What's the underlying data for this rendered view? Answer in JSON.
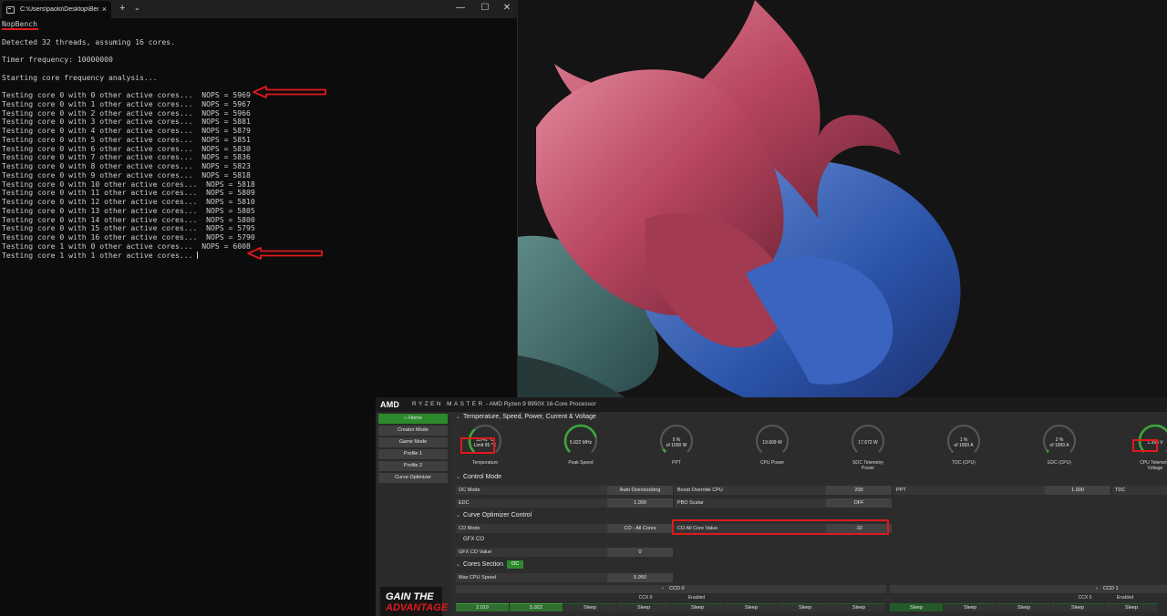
{
  "terminal": {
    "tab_title": "C:\\Users\\paolo\\Desktop\\Benc",
    "tab_close": "×",
    "new_tab": "+",
    "tab_dropdown": "⌄",
    "window_controls": {
      "minimize": "—",
      "maximize": "☐",
      "close": "✕"
    },
    "header_lines": [
      "NopBench",
      "",
      "Detected 32 threads, assuming 16 cores.",
      "",
      "Timer frequency: 10000000",
      "",
      "Starting core frequency analysis...",
      ""
    ],
    "results": [
      "Testing core 0 with 0 other active cores...  NOPS = 5969",
      "Testing core 0 with 1 other active cores...  NOPS = 5967",
      "Testing core 0 with 2 other active cores...  NOPS = 5966",
      "Testing core 0 with 3 other active cores...  NOPS = 5881",
      "Testing core 0 with 4 other active cores...  NOPS = 5879",
      "Testing core 0 with 5 other active cores...  NOPS = 5851",
      "Testing core 0 with 6 other active cores...  NOPS = 5830",
      "Testing core 0 with 7 other active cores...  NOPS = 5836",
      "Testing core 0 with 8 other active cores...  NOPS = 5823",
      "Testing core 0 with 9 other active cores...  NOPS = 5818",
      "Testing core 0 with 10 other active cores...  NOPS = 5818",
      "Testing core 0 with 11 other active cores...  NOPS = 5809",
      "Testing core 0 with 12 other active cores...  NOPS = 5810",
      "Testing core 0 with 13 other active cores...  NOPS = 5805",
      "Testing core 0 with 14 other active cores...  NOPS = 5800",
      "Testing core 0 with 15 other active cores...  NOPS = 5795",
      "Testing core 0 with 16 other active cores...  NOPS = 5790",
      "Testing core 1 with 0 other active cores...  NOPS = 6008",
      "Testing core 1 with 1 other active cores... "
    ]
  },
  "ryzen_master": {
    "logo": "AMD",
    "brand": "RYZEN MASTER",
    "processor": "-  AMD Ryzen 9 9950X 16-Core Processor",
    "sidebar": [
      {
        "label": "Home",
        "active": true
      },
      {
        "label": "Creator Mode",
        "active": false
      },
      {
        "label": "Game Mode",
        "active": false
      },
      {
        "label": "Profile 1",
        "active": false
      },
      {
        "label": "Profile 2",
        "active": false
      },
      {
        "label": "Curve Optimizer",
        "active": false
      }
    ],
    "banner": {
      "line1": "GAIN THE",
      "line2": "ADVANTAGE"
    },
    "sections": {
      "temps": "Temperature, Speed, Power, Current & Voltage",
      "control": "Control Mode",
      "curve": "Curve Optimizer Control",
      "gfx": "GFX CO",
      "cores": "Cores Section",
      "cores_tag": "OC"
    },
    "gauges": [
      {
        "line1": "33.41 °C",
        "line2": "Limit 95 °C",
        "label": "Temperature",
        "fill": 0.35,
        "color": "#3aa83a"
      },
      {
        "line1": "5.922  MHz",
        "line2": "",
        "label": "Peak Speed",
        "fill": 0.78,
        "color": "#3aa83a"
      },
      {
        "line1": "5 %",
        "line2": "of 1000 W",
        "label": "PPT",
        "fill": 0.05,
        "color": "#3aa83a"
      },
      {
        "line1": "19.609 W",
        "line2": "",
        "label": "CPU Power",
        "fill": 0.0,
        "color": "#3aa83a"
      },
      {
        "line1": "17.672 W",
        "line2": "",
        "label": "SOC Telemetry\nPower",
        "fill": 0.0,
        "color": "#3aa83a"
      },
      {
        "line1": "1 %",
        "line2": "of 1000 A",
        "label": "TDC (CPU)",
        "fill": 0.01,
        "color": "#3aa83a"
      },
      {
        "line1": "3 %",
        "line2": "of 1000 A",
        "label": "EDC (CPU)",
        "fill": 0.03,
        "color": "#3aa83a"
      },
      {
        "line1": "1.395 V",
        "line2": "",
        "label": "CPU Telemetry\nVoltage",
        "fill": 0.9,
        "color": "#3aa83a"
      }
    ],
    "control_rows": [
      {
        "label": "OC Mode",
        "value": "Auto Overclocking"
      },
      {
        "label": "Boost Override CPU",
        "value": "200"
      },
      {
        "label": "PPT",
        "value": "1.000"
      },
      {
        "label": "TDC",
        "value": ""
      },
      {
        "label": "EDC",
        "value": "1.000"
      },
      {
        "label": "PBO Scalar",
        "value": "OFF"
      }
    ],
    "curve_rows": [
      {
        "label": "CO Mode",
        "value": "CO - All Cores"
      },
      {
        "label": "CO All Core Value",
        "value": "-32"
      }
    ],
    "gfx_row": {
      "label": "GFX CO Value",
      "value": "0"
    },
    "max_cpu_speed": {
      "label": "Max CPU Speed",
      "value": "5.950"
    },
    "ccd": [
      {
        "name": "CCD 0",
        "ccx": "CCX 0",
        "status": "Enabled"
      },
      {
        "name": "CCD 1",
        "ccx": "CCX 0",
        "status": "Enabled"
      }
    ],
    "core_cells_ccd0": [
      "2.019",
      "5.922",
      "Sleep",
      "Sleep",
      "Sleep",
      "Sleep",
      "Sleep",
      "Sleep"
    ],
    "core_cells_ccd1": [
      "Sleep",
      "Sleep",
      "Sleep",
      "Sleep",
      "Sleep"
    ]
  },
  "colors": {
    "highlight": "#e0191c",
    "accent_green": "#2c8a2c",
    "terminal_text": "#cccccc"
  }
}
